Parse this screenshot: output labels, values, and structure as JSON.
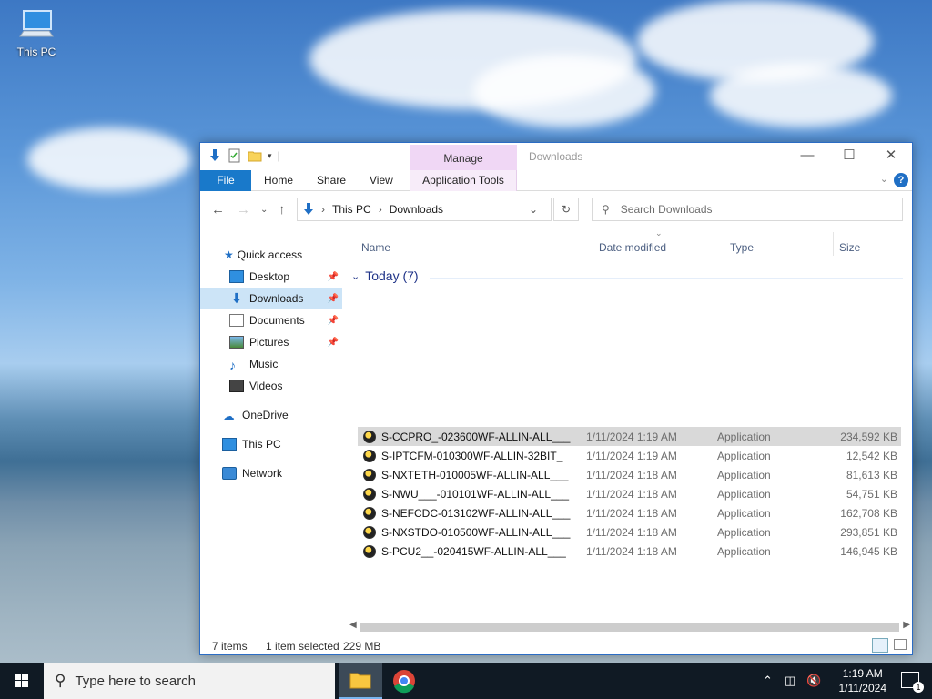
{
  "desktop": {
    "icon_label": "This PC"
  },
  "window": {
    "title": "Downloads",
    "manage_tab": "Manage",
    "ribbon_tabs": {
      "file": "File",
      "home": "Home",
      "share": "Share",
      "view": "View",
      "app_tools": "Application Tools"
    },
    "breadcrumb": [
      "This PC",
      "Downloads"
    ],
    "search_placeholder": "Search Downloads"
  },
  "nav": {
    "quick_access": "Quick access",
    "items": [
      {
        "label": "Desktop",
        "pinned": true
      },
      {
        "label": "Downloads",
        "pinned": true,
        "selected": true
      },
      {
        "label": "Documents",
        "pinned": true
      },
      {
        "label": "Pictures",
        "pinned": true
      },
      {
        "label": "Music",
        "pinned": false
      },
      {
        "label": "Videos",
        "pinned": false
      }
    ],
    "onedrive": "OneDrive",
    "this_pc": "This PC",
    "network": "Network"
  },
  "columns": {
    "name": "Name",
    "date": "Date modified",
    "type": "Type",
    "size": "Size"
  },
  "group_label": "Today (7)",
  "files": [
    {
      "name": "S-CCPRO_-023600WF-ALLIN-ALL___",
      "date": "1/11/2024 1:19 AM",
      "type": "Application",
      "size": "234,592 KB",
      "selected": true
    },
    {
      "name": "S-IPTCFM-010300WF-ALLIN-32BIT_",
      "date": "1/11/2024 1:19 AM",
      "type": "Application",
      "size": "12,542 KB"
    },
    {
      "name": "S-NXTETH-010005WF-ALLIN-ALL___",
      "date": "1/11/2024 1:18 AM",
      "type": "Application",
      "size": "81,613 KB"
    },
    {
      "name": "S-NWU___-010101WF-ALLIN-ALL___",
      "date": "1/11/2024 1:18 AM",
      "type": "Application",
      "size": "54,751 KB"
    },
    {
      "name": "S-NEFCDC-013102WF-ALLIN-ALL___",
      "date": "1/11/2024 1:18 AM",
      "type": "Application",
      "size": "162,708 KB"
    },
    {
      "name": "S-NXSTDO-010500WF-ALLIN-ALL___",
      "date": "1/11/2024 1:18 AM",
      "type": "Application",
      "size": "293,851 KB"
    },
    {
      "name": "S-PCU2__-020415WF-ALLIN-ALL___",
      "date": "1/11/2024 1:18 AM",
      "type": "Application",
      "size": "146,945 KB"
    }
  ],
  "status": {
    "items": "7 items",
    "selected": "1 item selected",
    "size": "229 MB"
  },
  "taskbar": {
    "search_placeholder": "Type here to search",
    "time": "1:19 AM",
    "date": "1/11/2024",
    "notification_count": "1"
  },
  "colors": {
    "accent": "#1979ca",
    "manage_tab": "#f0d7f5",
    "selection": "#cce4f7"
  }
}
